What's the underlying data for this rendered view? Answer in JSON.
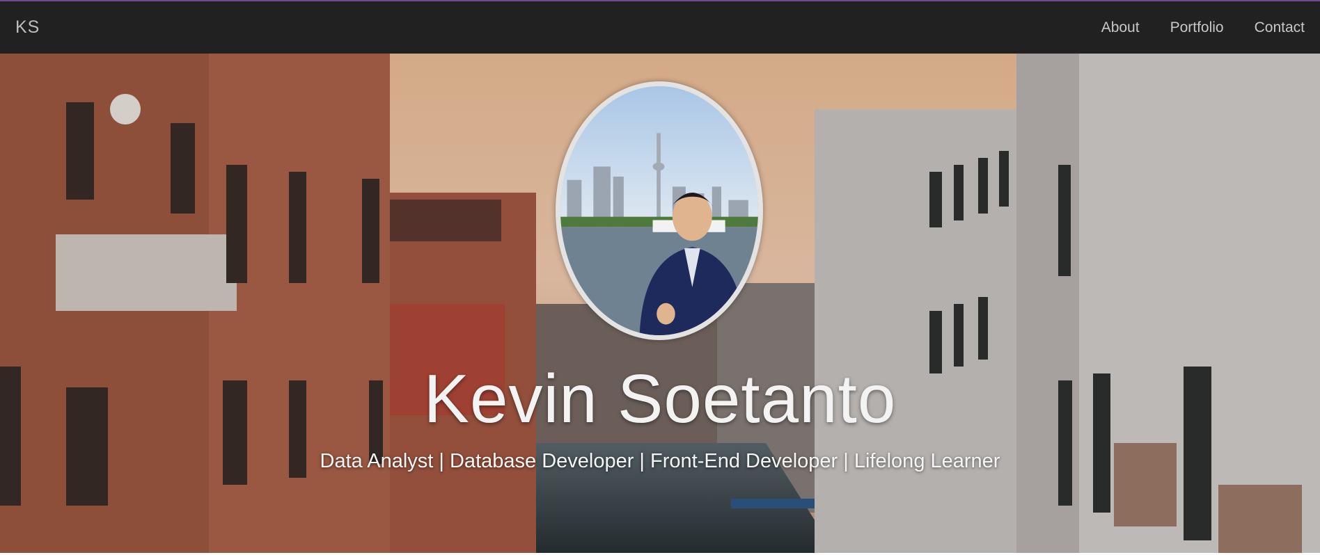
{
  "nav": {
    "brand": "KS",
    "links": [
      {
        "label": "About"
      },
      {
        "label": "Portfolio"
      },
      {
        "label": "Contact"
      }
    ]
  },
  "hero": {
    "name": "Kevin Soetanto",
    "tagline": "Data Analyst | Database Developer | Front-End Developer | Lifelong Learner",
    "background": "venice-canal-photo",
    "portrait": "profile-photo-toronto-skyline"
  },
  "colors": {
    "navbar": "#212121",
    "nav_text": "#c8c8c8",
    "hero_text": "#f3f3f3",
    "portrait_border": "#e3e3e3"
  }
}
